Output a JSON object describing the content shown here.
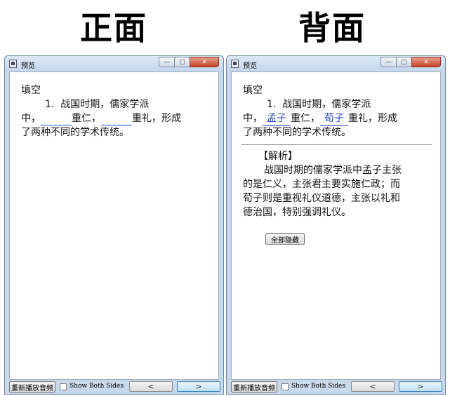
{
  "headings": {
    "front": "正面",
    "back": "背面"
  },
  "window": {
    "title": "预览",
    "minimize": "—",
    "maximize": "▢",
    "close": "✕"
  },
  "card": {
    "title": "填空",
    "line1": "1.  战国时期，儒家学派",
    "front_line2_a": "中，",
    "front_line2_b": "重仁，",
    "front_line2_c": "重礼，形成",
    "line3": "了两种不同的学术传统。",
    "answer1": "孟子",
    "answer2": "荀子",
    "analysis_label": "【解析】",
    "analysis_lines": [
      "战国时期的儒家学派中孟子主张",
      "的是仁义，主张君主要实施仁政；而",
      "荀子则是重视礼仪道德，主张以礼和",
      "德治国，特别强调礼仪。"
    ],
    "hide_all": "全部隐藏"
  },
  "bottom": {
    "replay": "重新播放音频",
    "show_both": "Show Both Sides",
    "prev": "<",
    "next": ">"
  }
}
